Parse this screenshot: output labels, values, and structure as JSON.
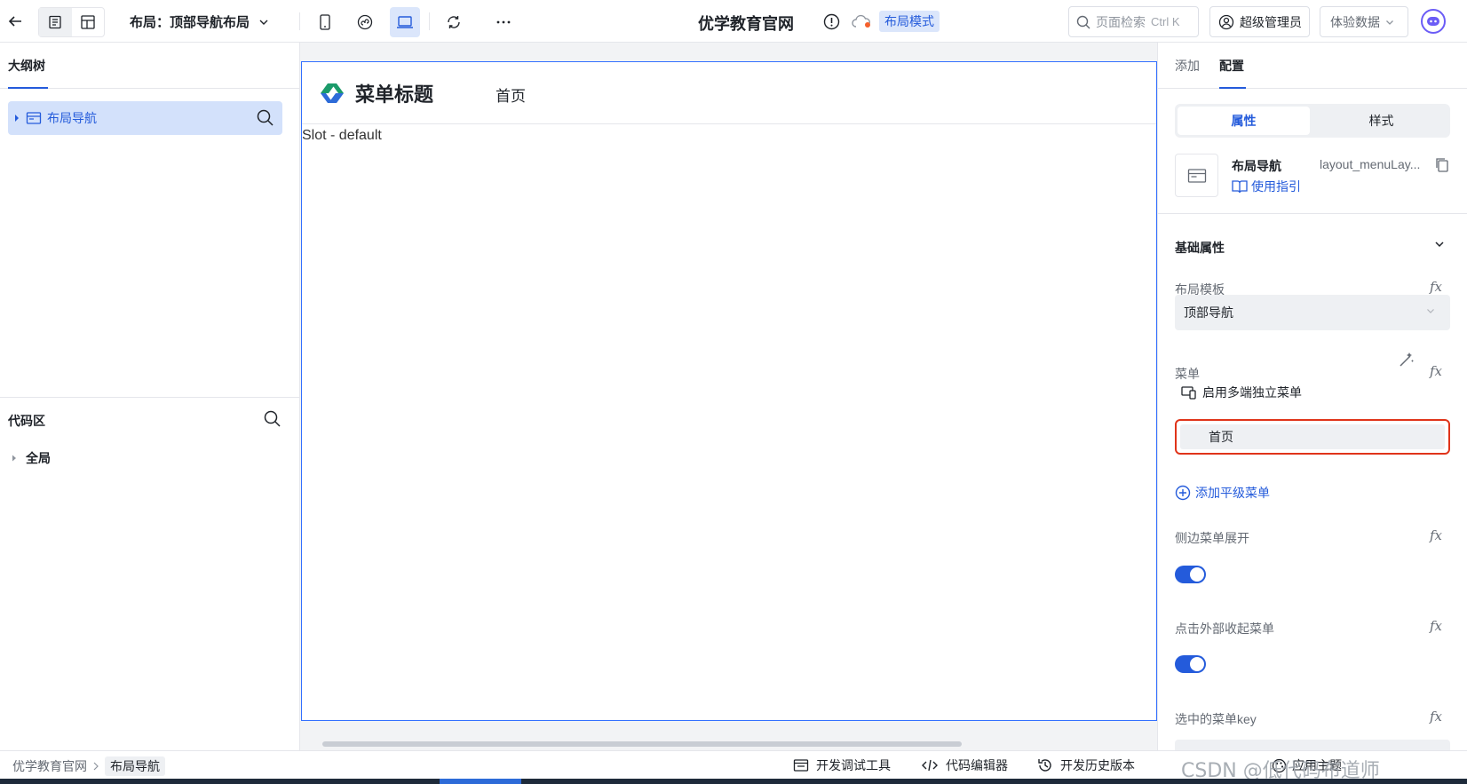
{
  "topbar": {
    "layout_label": "布局：顶部导航布局",
    "site_title": "优学教育官网",
    "mode_badge": "布局模式",
    "search_placeholder": "页面检索",
    "search_shortcut": "Ctrl K",
    "user_label": "超级管理员",
    "data_label": "体验数据"
  },
  "left": {
    "outline_tab": "大纲树",
    "tree_item": "布局导航",
    "code_area_title": "代码区",
    "code_global": "全局"
  },
  "canvas": {
    "menu_title": "菜单标题",
    "nav_home": "首页",
    "slot_text": "Slot - default"
  },
  "right": {
    "tab_add": "添加",
    "tab_config": "配置",
    "seg_props": "属性",
    "seg_style": "样式",
    "component_name": "布局导航",
    "component_id": "layout_menuLay...",
    "guide_link": "使用指引",
    "section_basic": "基础属性",
    "layout_template_label": "布局模板",
    "layout_template_value": "顶部导航",
    "menu_label": "菜单",
    "multi_menu": "启用多端独立菜单",
    "menu_item_home": "首页",
    "add_menu": "添加平级菜单",
    "side_expand_label": "侧边菜单展开",
    "side_expand_on": true,
    "click_outside_label": "点击外部收起菜单",
    "click_outside_on": true,
    "selected_key_label": "选中的菜单key",
    "fx": "fx"
  },
  "bottombar": {
    "crumb_root": "优学教育官网",
    "crumb_current": "布局导航",
    "dev_tools": "开发调试工具",
    "code_editor": "代码编辑器",
    "history": "开发历史版本",
    "apply_theme": "应用主题",
    "watermark": "CSDN @低代码布道师"
  },
  "colors": {
    "accent": "#245bdb",
    "highlight_bg": "#d3e1fb",
    "danger_border": "#e0341a"
  }
}
